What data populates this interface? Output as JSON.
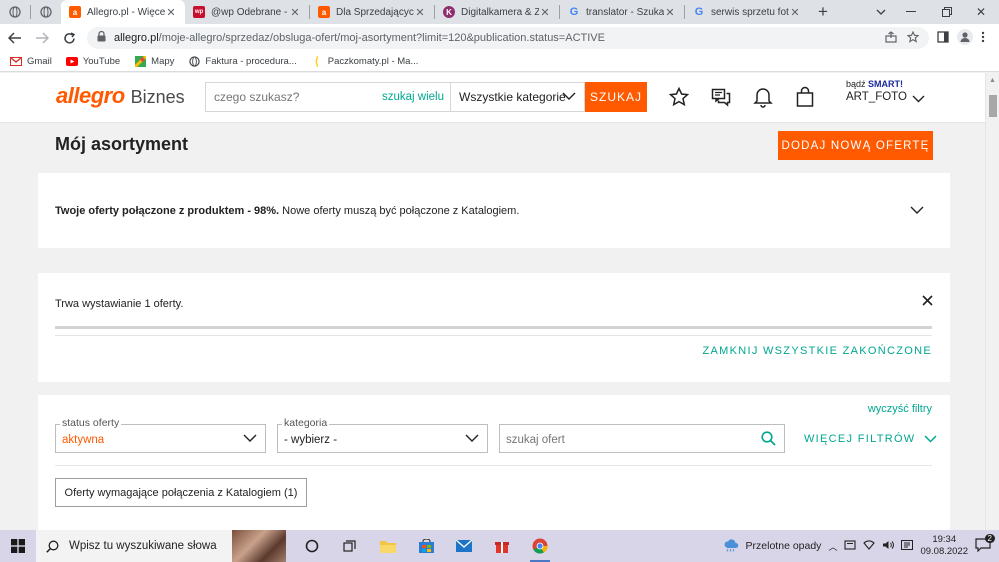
{
  "browser": {
    "tabs": [
      {
        "title": "",
        "favicon": "globe-icon",
        "active": false
      },
      {
        "title": "",
        "favicon": "globe-icon",
        "active": false
      },
      {
        "title": "Allegro.pl - Więcej",
        "favicon": "allegro-icon",
        "active": true
      },
      {
        "title": "@wp Odebrane - W",
        "favicon": "wp-mail-icon",
        "active": false
      },
      {
        "title": "Dla Sprzedających",
        "favicon": "allegro-icon",
        "active": false
      },
      {
        "title": "Digitalkamera & Zu",
        "favicon": "k-icon",
        "active": false
      },
      {
        "title": "translator - Szukaj w",
        "favicon": "google-icon",
        "active": false
      },
      {
        "title": "serwis sprzetu fotog",
        "favicon": "google-icon",
        "active": false
      }
    ],
    "url_host": "allegro.pl",
    "url_path": "/moje-allegro/sprzedaz/obsluga-ofert/moj-asortyment?limit=120&publication.status=ACTIVE",
    "bookmarks": [
      {
        "label": "Gmail",
        "icon": "gmail-icon"
      },
      {
        "label": "YouTube",
        "icon": "youtube-icon"
      },
      {
        "label": "Mapy",
        "icon": "maps-icon"
      },
      {
        "label": "Faktura - procedura...",
        "icon": "globe-icon"
      },
      {
        "label": "Paczkomaty.pl - Ma...",
        "icon": "paczkomaty-icon"
      }
    ]
  },
  "header": {
    "logo_main": "allegro",
    "logo_sub": "Biznes",
    "search_placeholder": "czego szukasz?",
    "search_multi": "szukaj wielu",
    "category": "Wszystkie kategorie",
    "search_button": "SZUKAJ",
    "smart_prefix": "bądź",
    "smart_label": "SMART!",
    "account_name": "ART_FOTO"
  },
  "page": {
    "title": "Mój asortyment",
    "add_offer": "DODAJ NOWĄ OFERTĘ",
    "catalog_bold": "Twoje oferty połączone z produktem - 98%.",
    "catalog_rest": " Nowe oferty muszą być połączone z Katalogiem.",
    "listing_status": "Trwa wystawianie 1 oferty.",
    "close_all": "ZAMKNIJ WSZYSTKIE ZAKOŃCZONE",
    "clear_filters": "wyczyść filtry",
    "status_label": "status oferty",
    "status_value": "aktywna",
    "category_label": "kategoria",
    "category_value": "- wybierz -",
    "search_offers_placeholder": "szukaj ofert",
    "more_filters": "WIĘCEJ FILTRÓW",
    "catalog_chip": "Oferty wymagające połączenia z Katalogiem (1)"
  },
  "taskbar": {
    "search_placeholder": "Wpisz tu wyszukiwane słowa",
    "weather": "Przelotne opady",
    "time": "19:34",
    "date": "09.08.2022",
    "notifications": "2"
  },
  "colors": {
    "accent": "#ff5a00",
    "teal": "#00a790",
    "smart": "#1a2b99"
  }
}
